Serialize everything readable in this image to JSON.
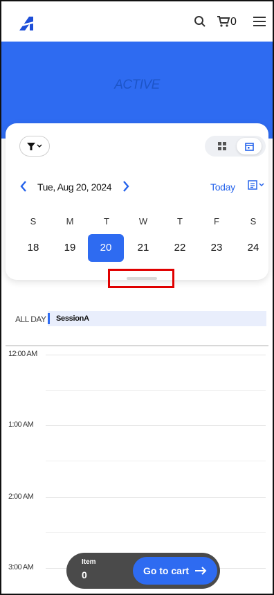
{
  "header": {
    "cart_count": "0"
  },
  "hero": {
    "brand": "ACTIVE"
  },
  "calendar": {
    "date_label": "Tue, Aug 20, 2024",
    "today_label": "Today",
    "weekdays": [
      "S",
      "M",
      "T",
      "W",
      "T",
      "F",
      "S"
    ],
    "days": [
      "18",
      "19",
      "20",
      "21",
      "22",
      "23",
      "24"
    ],
    "selected_day": "20"
  },
  "schedule": {
    "allday_label": "ALL DAY",
    "allday_event": "SessionA",
    "times": [
      "12:00 AM",
      "1:00 AM",
      "2:00 AM",
      "3:00 AM"
    ]
  },
  "cart": {
    "item_label": "Item",
    "item_count": "0",
    "go_label": "Go to cart"
  },
  "colors": {
    "accent": "#2e6bf1",
    "highlight_box": "#e00000",
    "cart_bar": "#4a4a4a"
  }
}
